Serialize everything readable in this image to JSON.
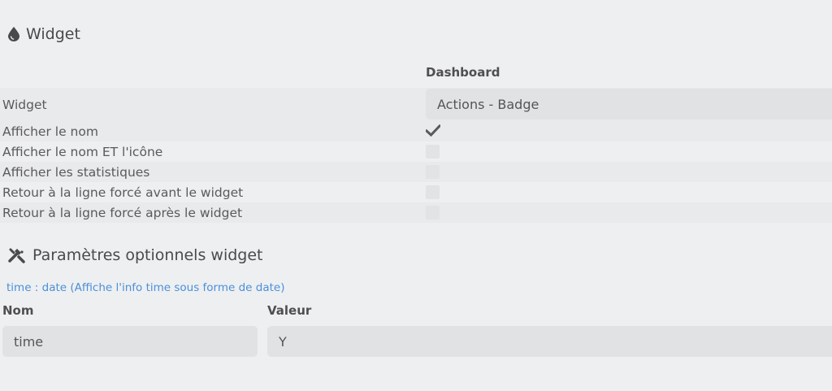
{
  "widget_section": {
    "icon": "water-drop-icon",
    "title": "Widget"
  },
  "table": {
    "column_header": "Dashboard",
    "rows": [
      {
        "label": "Widget",
        "select_value": "Actions - Badge"
      },
      {
        "label": "Afficher le nom",
        "checked": true
      },
      {
        "label": "Afficher le nom ET l'icône",
        "checked": false
      },
      {
        "label": "Afficher les statistiques",
        "checked": false
      },
      {
        "label": "Retour à la ligne forcé avant le widget",
        "checked": false
      },
      {
        "label": "Retour à la ligne forcé après le widget",
        "checked": false
      }
    ]
  },
  "params_section": {
    "icon": "tools-icon",
    "title": "Paramètres optionnels widget",
    "hint": "time : date (Affiche l'info time sous forme de date)",
    "name_label": "Nom",
    "value_label": "Valeur",
    "name_value": "time",
    "value_value": "Y"
  },
  "colors": {
    "background": "#eeeff1",
    "row_alt": "#e9eaec",
    "field": "#e1e2e3",
    "hint_link": "#4a90d9"
  }
}
